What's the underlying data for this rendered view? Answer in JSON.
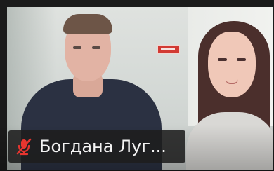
{
  "participant": {
    "name": "Богдана Луг...",
    "muted_icon": "microphone-muted-icon",
    "muted_icon_color": "#e7352f"
  }
}
